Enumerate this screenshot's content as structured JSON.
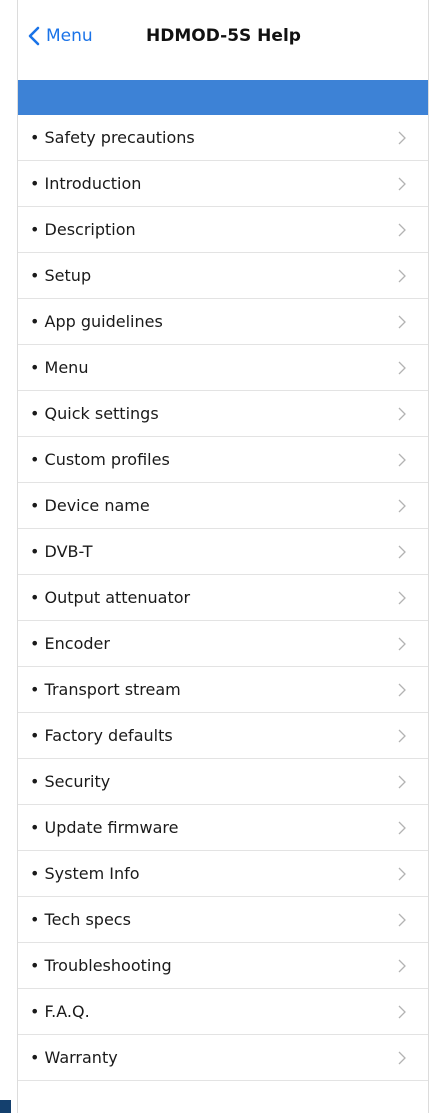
{
  "nav": {
    "back_label": "Menu",
    "title": "HDMOD-5S Help"
  },
  "colors": {
    "accent": "#1a73e8",
    "band": "#3d82d6",
    "corner": "#14406e"
  },
  "items": [
    {
      "label": "• Safety precautions"
    },
    {
      "label": "• Introduction"
    },
    {
      "label": "• Description"
    },
    {
      "label": "• Setup"
    },
    {
      "label": "• App guidelines"
    },
    {
      "label": "• Menu"
    },
    {
      "label": "• Quick settings"
    },
    {
      "label": "• Custom profiles"
    },
    {
      "label": "• Device name"
    },
    {
      "label": "• DVB-T"
    },
    {
      "label": "• Output attenuator"
    },
    {
      "label": "• Encoder"
    },
    {
      "label": "• Transport stream"
    },
    {
      "label": "• Factory defaults"
    },
    {
      "label": "• Security"
    },
    {
      "label": "• Update firmware"
    },
    {
      "label": "• System Info"
    },
    {
      "label": "• Tech specs"
    },
    {
      "label": "• Troubleshooting"
    },
    {
      "label": "• F.A.Q."
    },
    {
      "label": "• Warranty"
    }
  ]
}
